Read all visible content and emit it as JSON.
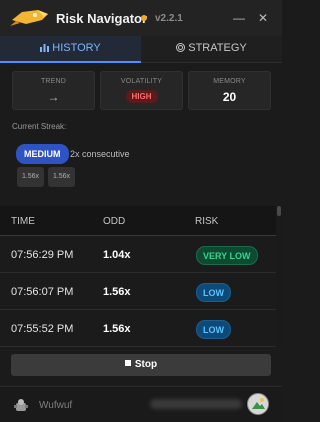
{
  "app": {
    "title": "Risk Navigator",
    "version": "v2.2.1"
  },
  "window": {
    "minimize": "—",
    "close": "✕"
  },
  "tabs": [
    {
      "label": "HISTORY",
      "icon": "bar-chart-icon",
      "active": true
    },
    {
      "label": "STRATEGY",
      "icon": "target-icon",
      "active": false
    }
  ],
  "stats": {
    "trend": {
      "label": "TREND",
      "value": "→"
    },
    "volatility": {
      "label": "VOLATILITY",
      "value": "HIGH"
    },
    "memory": {
      "label": "MEMORY",
      "value": "20"
    }
  },
  "streak": {
    "label": "Current Streak:",
    "level": "MEDIUM",
    "count_text": "2x consecutive",
    "chips": [
      "1.56x",
      "1.56x"
    ]
  },
  "table": {
    "headers": {
      "time": "TIME",
      "odd": "ODD",
      "risk": "RISK"
    },
    "rows": [
      {
        "time": "07:56:29 PM",
        "odd": "1.04x",
        "risk": "VERY LOW"
      },
      {
        "time": "07:56:07 PM",
        "odd": "1.56x",
        "risk": "LOW"
      },
      {
        "time": "07:55:52 PM",
        "odd": "1.56x",
        "risk": "LOW"
      }
    ]
  },
  "controls": {
    "stop_label": "Stop"
  },
  "footer": {
    "username": "Wufwuf"
  },
  "colors": {
    "accent": "#4c8dff",
    "status_dot": "#f5a623",
    "risk_very_low": "#37d489",
    "risk_low": "#5cc2ff",
    "volatility_high": "#ff6b6b",
    "streak_medium": "#2e54c4"
  }
}
